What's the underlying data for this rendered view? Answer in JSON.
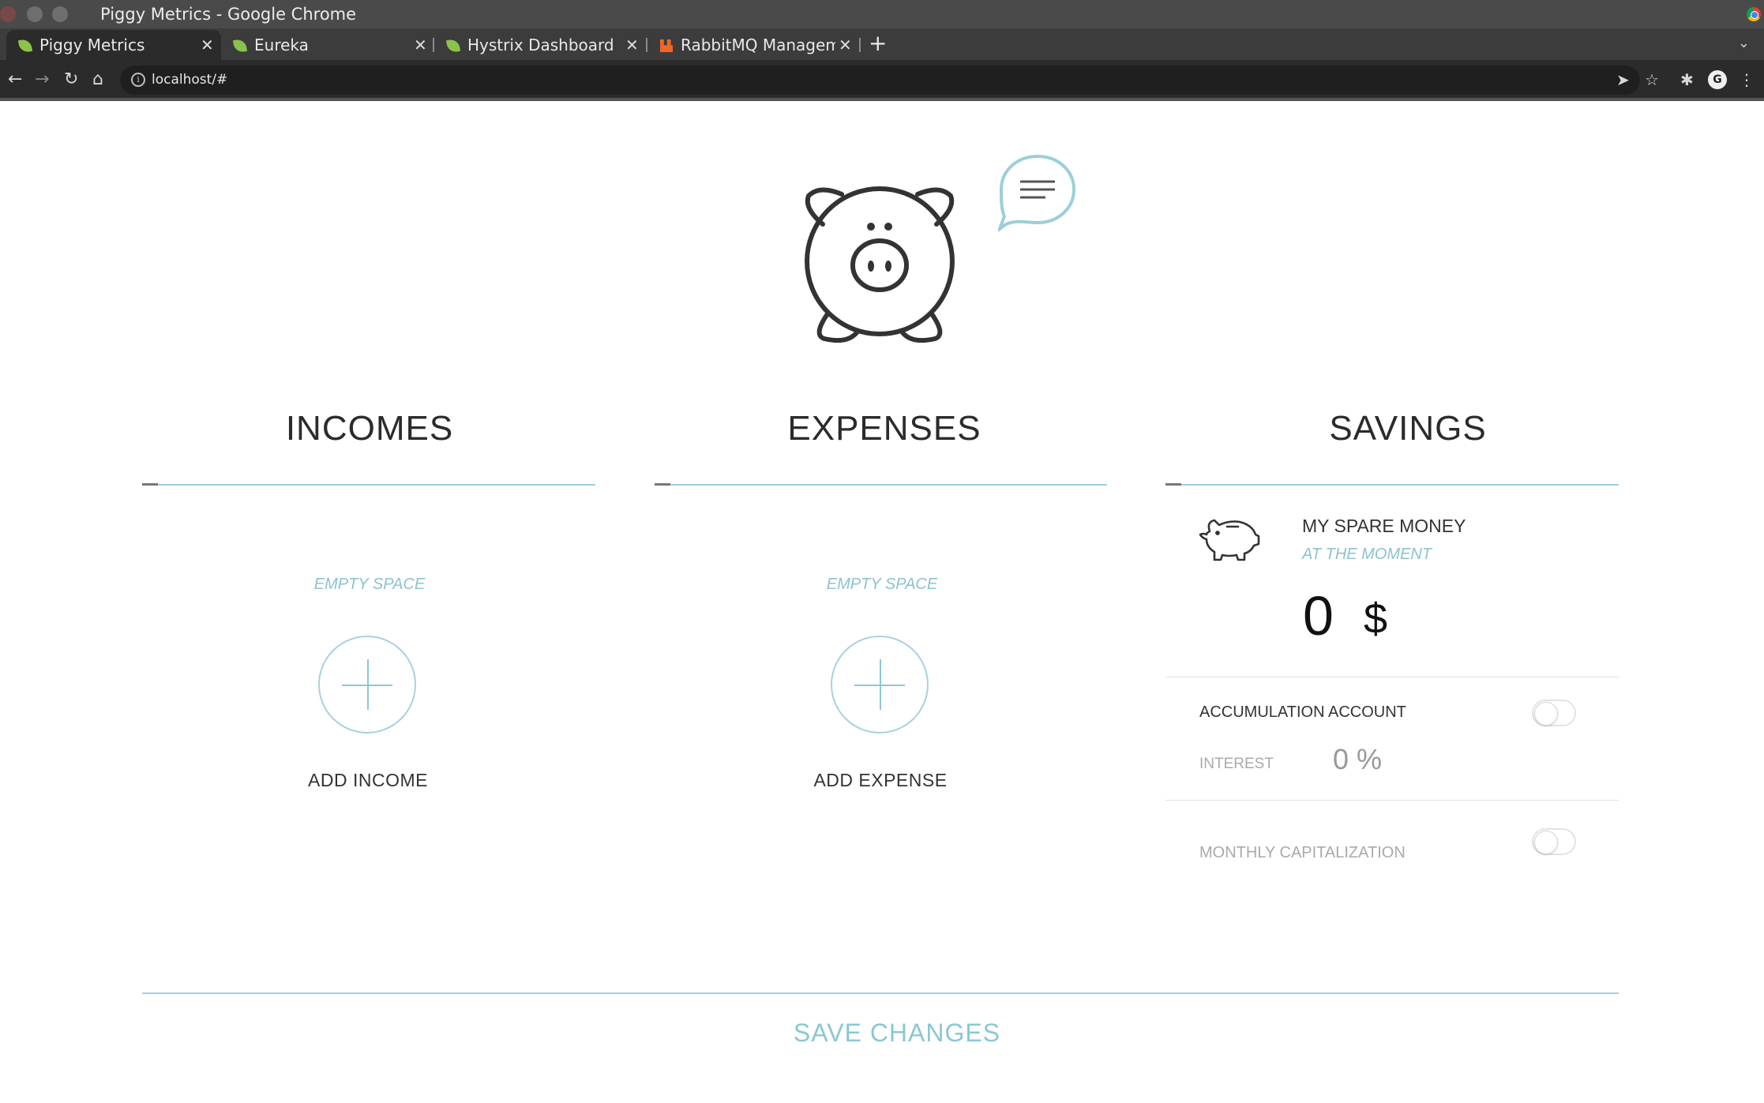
{
  "window": {
    "title": "Piggy Metrics - Google Chrome"
  },
  "tabs": [
    {
      "label": "Piggy Metrics",
      "icon": "spring-leaf-icon",
      "active": true
    },
    {
      "label": "Eureka",
      "icon": "spring-leaf-icon",
      "active": false
    },
    {
      "label": "Hystrix Dashboard",
      "icon": "spring-leaf-icon",
      "active": false
    },
    {
      "label": "RabbitMQ Manageme",
      "icon": "rabbitmq-icon",
      "active": false
    }
  ],
  "address_bar": {
    "url": "localhost/#"
  },
  "columns": {
    "incomes": {
      "title": "INCOMES",
      "empty_text": "EMPTY SPACE",
      "add_label": "ADD INCOME"
    },
    "expenses": {
      "title": "EXPENSES",
      "empty_text": "EMPTY SPACE",
      "add_label": "ADD EXPENSE"
    },
    "savings": {
      "title": "SAVINGS",
      "spare_title": "MY SPARE MONEY",
      "spare_subtitle": "AT THE MOMENT",
      "amount": "0",
      "currency": "$",
      "accumulation_label": "ACCUMULATION ACCOUNT",
      "interest_label": "INTEREST",
      "interest_value": "0 %",
      "monthly_label": "MONTHLY CAPITALIZATION",
      "accumulation_on": false,
      "monthly_on": false
    }
  },
  "footer": {
    "save_label": "SAVE CHANGES"
  },
  "colors": {
    "accent": "#8cc7d2",
    "text": "#333333"
  }
}
